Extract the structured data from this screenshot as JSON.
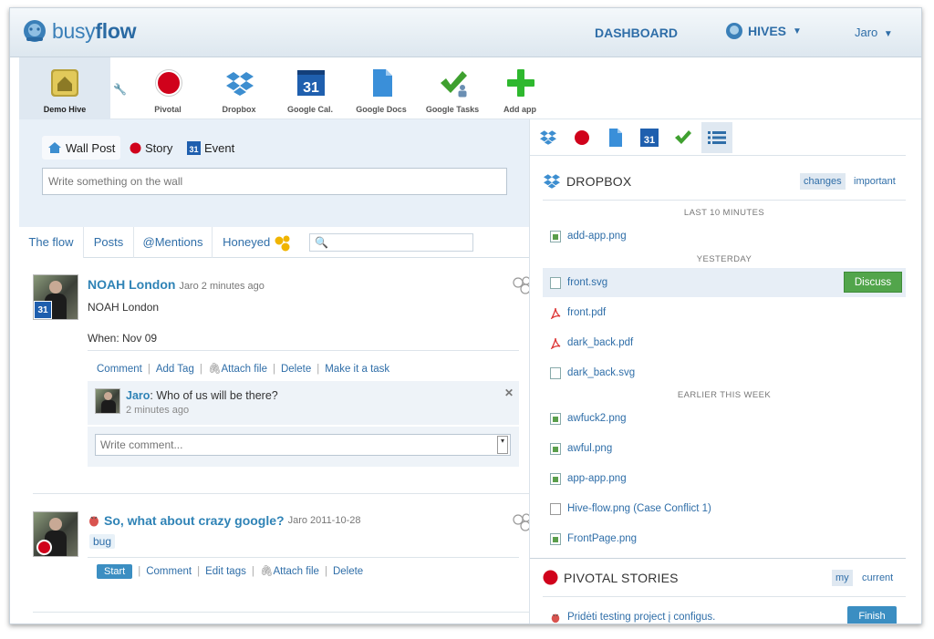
{
  "header": {
    "brand_prefix": "busy",
    "brand_suffix": "flow",
    "dashboard": "DASHBOARD",
    "hives": "HIVES",
    "user": "Jaro"
  },
  "apps": [
    {
      "label": "Demo Hive",
      "icon": "hive-icon"
    },
    {
      "label": "Pivotal",
      "icon": "pivotal-icon"
    },
    {
      "label": "Dropbox",
      "icon": "dropbox-icon"
    },
    {
      "label": "Google Cal.",
      "icon": "calendar-icon"
    },
    {
      "label": "Google Docs",
      "icon": "docs-icon"
    },
    {
      "label": "Google Tasks",
      "icon": "tasks-icon"
    },
    {
      "label": "Add app",
      "icon": "plus-icon"
    }
  ],
  "composer": {
    "wall_post": "Wall Post",
    "story": "Story",
    "event": "Event",
    "calendar_day": "31",
    "wall_placeholder": "Write something on the wall"
  },
  "flow_tabs": {
    "the_flow": "The flow",
    "posts": "Posts",
    "mentions": "@Mentions",
    "honeyed": "Honeyed"
  },
  "post1": {
    "title": "NOAH London",
    "meta": "Jaro 2 minutes ago",
    "body": "NOAH London",
    "when": "When: Nov 09",
    "actions": [
      "Comment",
      "Add Tag",
      "Attach file",
      "Delete",
      "Make it a task"
    ],
    "comment_author": "Jaro",
    "comment_text": ": Who of us will be there?",
    "comment_time": "2 minutes ago",
    "comment_placeholder": "Write comment..."
  },
  "post2": {
    "title": "So, what about crazy google?",
    "meta": "Jaro 2011-10-28",
    "tag": "bug",
    "start": "Start",
    "actions": [
      "Comment",
      "Edit tags",
      "Attach file",
      "Delete"
    ]
  },
  "dropbox": {
    "title": "DROPBOX",
    "changes": "changes",
    "important": "important",
    "group1": "LAST 10 MINUTES",
    "group2": "YESTERDAY",
    "group3": "EARLIER THIS WEEK",
    "discuss": "Discuss",
    "files": [
      {
        "name": "add-app.png",
        "type": "png"
      },
      {
        "name": "front.svg",
        "type": "svg"
      },
      {
        "name": "front.pdf",
        "type": "pdf"
      },
      {
        "name": "dark_back.pdf",
        "type": "pdf"
      },
      {
        "name": "dark_back.svg",
        "type": "svg"
      },
      {
        "name": "awfuck2.png",
        "type": "png"
      },
      {
        "name": "awful.png",
        "type": "png"
      },
      {
        "name": "app-app.png",
        "type": "png"
      },
      {
        "name": "Hive-flow.png (Case Conflict 1)",
        "type": "blank"
      },
      {
        "name": "FrontPage.png",
        "type": "png"
      }
    ]
  },
  "pivotal": {
    "title": "PIVOTAL STORIES",
    "my": "my",
    "current": "current",
    "story": "Pridėti testing project į configus.",
    "finish": "Finish"
  },
  "colors": {
    "accent": "#2f6ea8",
    "link": "#2f83b6",
    "discuss_green": "#52a54b",
    "pivotal_red": "#d0021b"
  }
}
